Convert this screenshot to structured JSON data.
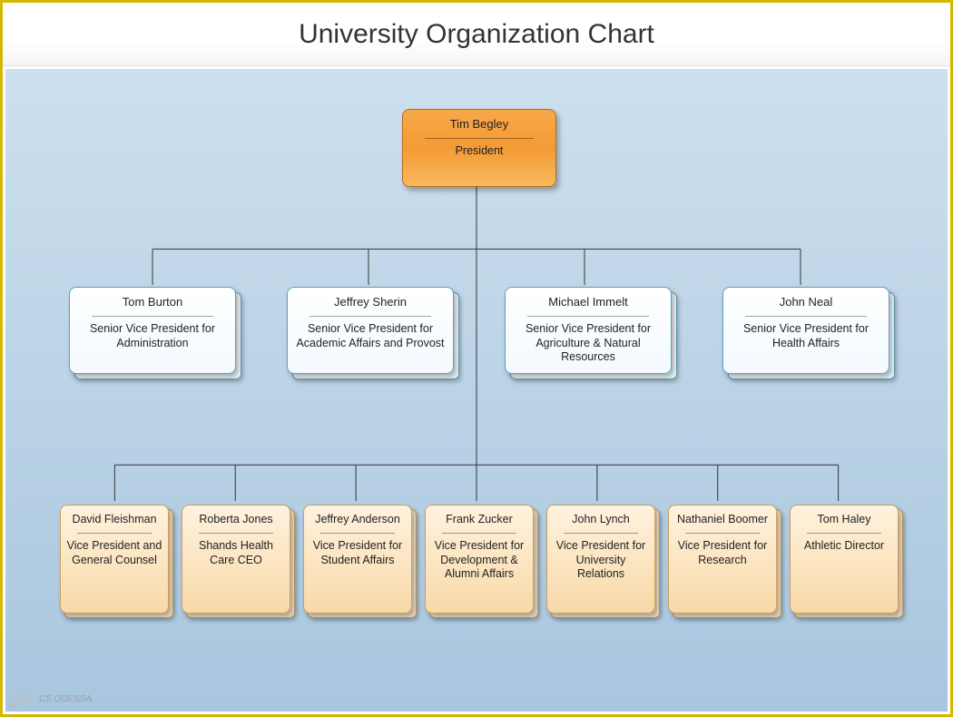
{
  "title": "University Organization Chart",
  "footer": "CS ODESSA",
  "president": {
    "name": "Tim Begley",
    "role": "President"
  },
  "level2": [
    {
      "name": "Tom Burton",
      "role": "Senior Vice President for Administration"
    },
    {
      "name": "Jeffrey Sherin",
      "role": "Senior Vice President for Academic Affairs and Provost"
    },
    {
      "name": "Michael Immelt",
      "role": "Senior Vice President for Agriculture & Natural Resources"
    },
    {
      "name": "John Neal",
      "role": "Senior Vice President for Health Affairs"
    }
  ],
  "level3": [
    {
      "name": "David Fleishman",
      "role": "Vice President and General Counsel"
    },
    {
      "name": "Roberta Jones",
      "role": "Shands Health Care CEO"
    },
    {
      "name": "Jeffrey Anderson",
      "role": "Vice President for Student Affairs"
    },
    {
      "name": "Frank Zucker",
      "role": "Vice President for Development & Alumni Affairs"
    },
    {
      "name": "John Lynch",
      "role": "Vice President for University Relations"
    },
    {
      "name": "Nathaniel Boomer",
      "role": "Vice President for Research"
    },
    {
      "name": "Tom Haley",
      "role": "Athletic Director"
    }
  ]
}
